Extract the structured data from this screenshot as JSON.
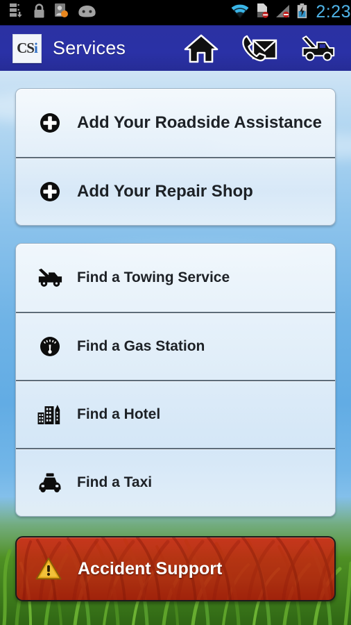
{
  "statusbar": {
    "time": "2:23",
    "left_icons": [
      "storage-download-icon",
      "lock-icon",
      "contact-sync-icon",
      "android-robot-icon"
    ],
    "right_icons": [
      "wifi-icon",
      "sd-card-disabled-icon",
      "signal-disabled-icon",
      "battery-charging-icon"
    ]
  },
  "header": {
    "logo_text_dark": "CS",
    "logo_text_accent": "i",
    "title": "Services",
    "accent_color": "#2b31a2",
    "icons": [
      {
        "name": "home-icon",
        "label": "Home"
      },
      {
        "name": "contact-us-icon",
        "label": "Contact"
      },
      {
        "name": "tow-truck-icon",
        "label": "Towing"
      }
    ]
  },
  "cards": [
    {
      "name": "add-services-card",
      "rows": [
        {
          "name": "add-roadside-assistance",
          "icon": "plus-circle-icon",
          "label": "Add Your Roadside Assistance",
          "size": "large"
        },
        {
          "name": "add-repair-shop",
          "icon": "plus-circle-icon",
          "label": "Add Your Repair Shop",
          "size": "large"
        }
      ]
    },
    {
      "name": "find-services-card",
      "rows": [
        {
          "name": "find-towing-service",
          "icon": "tow-truck-icon",
          "label": "Find a Towing Service",
          "size": "small"
        },
        {
          "name": "find-gas-station",
          "icon": "fuel-gauge-icon",
          "label": "Find a Gas Station",
          "size": "small"
        },
        {
          "name": "find-hotel",
          "icon": "buildings-icon",
          "label": "Find a Hotel",
          "size": "small"
        },
        {
          "name": "find-taxi",
          "icon": "taxi-icon",
          "label": "Find a Taxi",
          "size": "small"
        }
      ]
    }
  ],
  "accident": {
    "label": "Accident Support",
    "icon": "warning-triangle-icon",
    "color": "#cf1e0e"
  }
}
